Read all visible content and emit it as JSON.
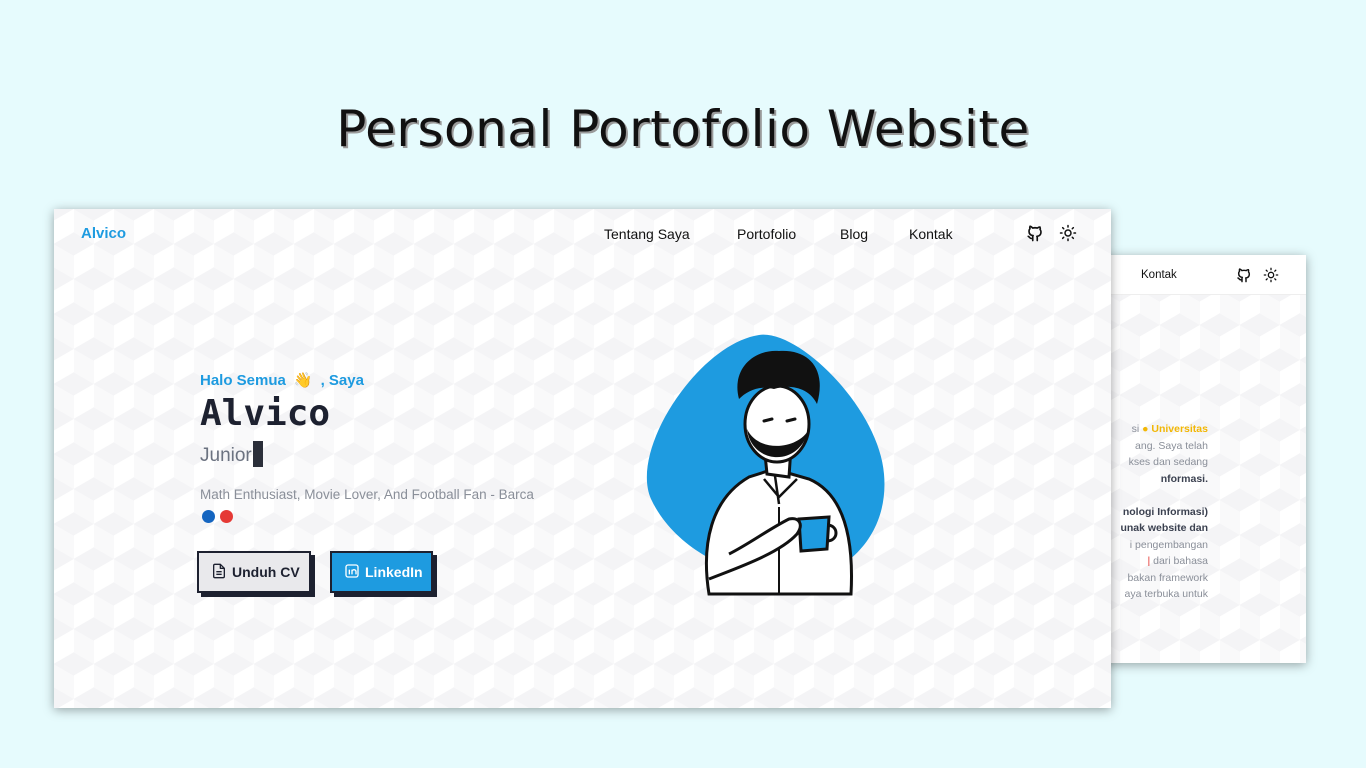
{
  "headline": "Personal Portofolio Website",
  "brand": {
    "logo_text": "Alvico"
  },
  "nav": {
    "items": [
      "Tentang Saya",
      "Portofolio",
      "Blog",
      "Kontak"
    ],
    "github_icon": "github-icon",
    "theme_icon": "sun-icon"
  },
  "hero": {
    "greeting_prefix": "Halo Semua",
    "greeting_emoji": "👋",
    "greeting_suffix": ", Saya",
    "name": "Alvico",
    "typed_role": "Junior",
    "tagline": "Math Enthusiast, Movie Lover, And Football Fan - Barca",
    "dot_colors": [
      "#1565c0",
      "#e53935"
    ],
    "cv_button": "Unduh CV",
    "linkedin_button": "LinkedIn"
  },
  "second_view": {
    "nav_item": "Kontak",
    "about_lines": [
      {
        "pre": "si ",
        "highlight": "Universitas",
        "post": ""
      },
      {
        "pre": "ang. Saya telah",
        "highlight": "",
        "post": ""
      },
      {
        "pre": "kses dan sedang",
        "highlight": "",
        "post": ""
      },
      {
        "pre": "nformasi.",
        "highlight": "",
        "post": "",
        "bold": true
      },
      {
        "pre": "",
        "highlight": "",
        "post": ""
      },
      {
        "pre": "nologi Informasi)",
        "highlight": "",
        "post": "",
        "bold": true
      },
      {
        "pre": "unak website dan",
        "highlight": "",
        "post": ""
      },
      {
        "pre": "i pengembangan",
        "highlight": "",
        "post": ""
      },
      {
        "pre": "dari bahasa",
        "highlight": "",
        "post": ""
      },
      {
        "pre": "bakan framework",
        "highlight": "",
        "post": ""
      },
      {
        "pre": "aya terbuka untuk",
        "highlight": "",
        "post": ""
      }
    ]
  },
  "colors": {
    "accent": "#1e9be0",
    "background": "#e6fbfd",
    "dark": "#1d2130"
  }
}
